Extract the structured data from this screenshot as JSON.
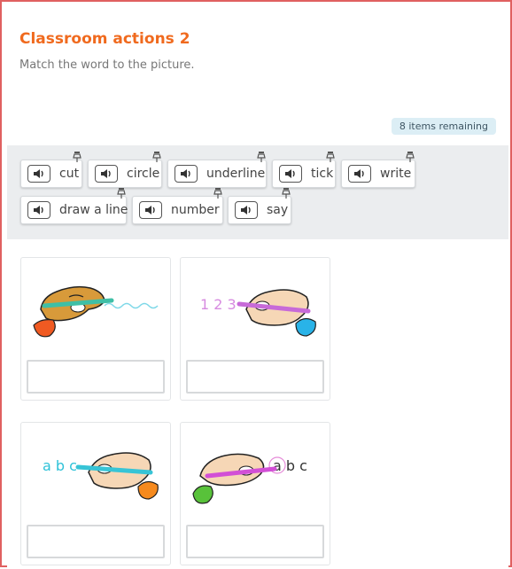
{
  "activity": {
    "title": "Classroom actions 2",
    "instructions": "Match the word to the picture.",
    "remaining": "8 items remaining"
  },
  "word_bank": [
    {
      "label": "cut",
      "icon": "speaker-icon"
    },
    {
      "label": "circle",
      "icon": "speaker-icon"
    },
    {
      "label": "underline",
      "icon": "speaker-icon"
    },
    {
      "label": "tick",
      "icon": "speaker-icon"
    },
    {
      "label": "write",
      "icon": "speaker-icon"
    },
    {
      "label": "draw a line",
      "icon": "speaker-icon"
    },
    {
      "label": "number",
      "icon": "speaker-icon"
    },
    {
      "label": "say",
      "icon": "speaker-icon"
    }
  ],
  "pictures": [
    {
      "name": "hand-drawing-wavy-line",
      "text": ""
    },
    {
      "name": "hand-writing-numbers",
      "text": "1 2 3"
    },
    {
      "name": "hand-writing-letters",
      "text": "a b c"
    },
    {
      "name": "hand-circling-letter",
      "text": "a b c"
    }
  ],
  "colors": {
    "accent": "#f06a1e",
    "badge_bg": "#dceef5",
    "bank_bg": "#ebedef"
  }
}
